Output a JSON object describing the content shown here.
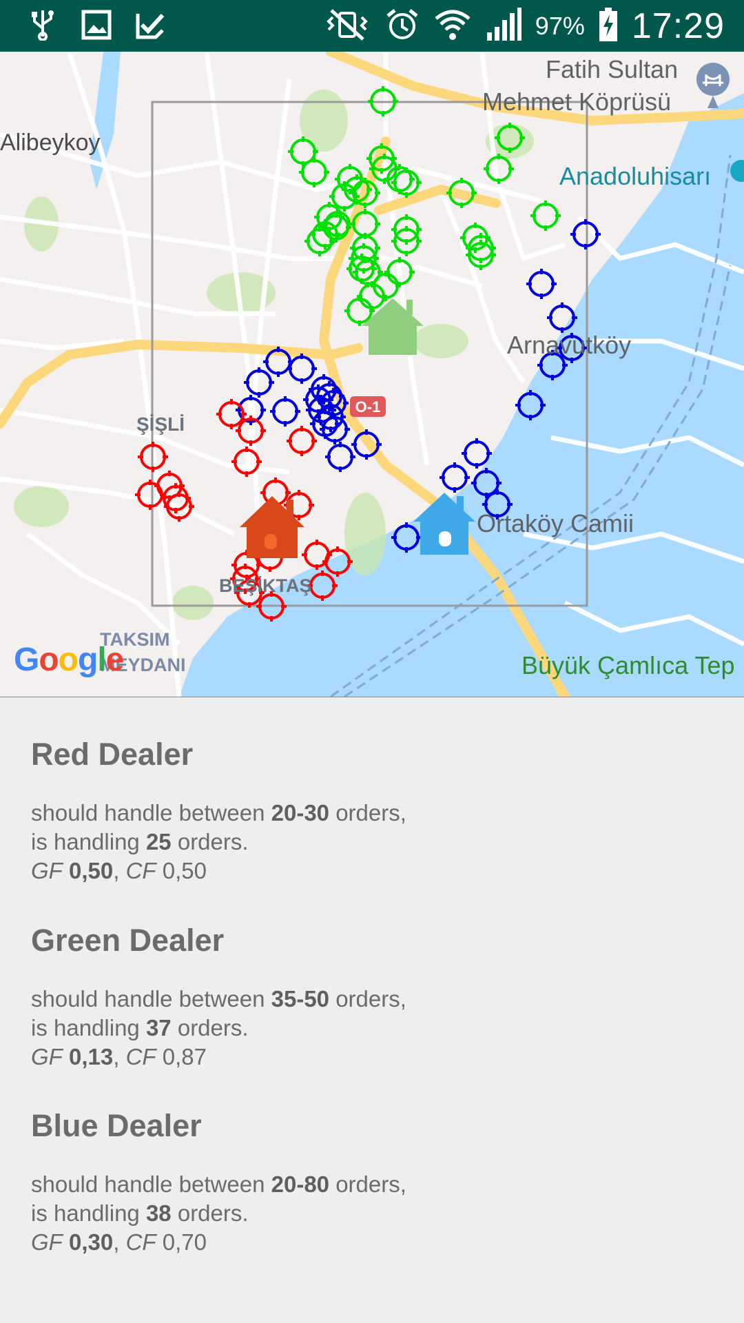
{
  "status_bar": {
    "left_icons": [
      "usb-icon",
      "image-icon",
      "task-done-icon"
    ],
    "right_icons": [
      "vibrate-mute-icon",
      "alarm-icon",
      "wifi-icon",
      "signal-icon"
    ],
    "battery_percent": "97%",
    "time": "17:29"
  },
  "map": {
    "labels": {
      "alibeykoy": "Alibeykoy",
      "fatih_line1": "Fatih Sultan",
      "fatih_line2": "Mehmet Köprüsü",
      "anadoluhisari": "Anadoluhisarı",
      "arnavutkoy": "Arnavutköy",
      "sisli": "ŞİŞLİ",
      "ortakoy": "Ortaköy Camii",
      "besiktas": "BEŞİKTAŞ",
      "taksim_line1": "TAKSIM",
      "taksim_line2": "MEYDANI",
      "buyuk_camlica": "Büyük Çamlıca Tep",
      "road_shield": "O-1"
    },
    "google_logo": "Google",
    "colors": {
      "red_dealer": "#ff0000",
      "green_dealer": "#00e000",
      "blue_dealer": "#0000dd",
      "water": "#aadaff",
      "highway": "#fdd77b"
    }
  },
  "dealers": [
    {
      "name": "Red Dealer",
      "should_prefix": "should handle between ",
      "range": "20-30",
      "should_suffix": " orders,",
      "handling_prefix": "is handling ",
      "handling": "25",
      "handling_suffix": " orders.",
      "gf_label": "GF",
      "gf": "0,50",
      "cf_label": "CF",
      "cf": "0,50"
    },
    {
      "name": "Green Dealer",
      "should_prefix": "should handle between ",
      "range": "35-50",
      "should_suffix": " orders,",
      "handling_prefix": "is handling ",
      "handling": "37",
      "handling_suffix": " orders.",
      "gf_label": "GF",
      "gf": "0,13",
      "cf_label": "CF",
      "cf": "0,87"
    },
    {
      "name": "Blue Dealer",
      "should_prefix": "should handle between ",
      "range": "20-80",
      "should_suffix": " orders,",
      "handling_prefix": "is handling ",
      "handling": "38",
      "handling_suffix": " orders.",
      "gf_label": "GF",
      "gf": "0,30",
      "cf_label": "CF",
      "cf": "0,70"
    }
  ]
}
